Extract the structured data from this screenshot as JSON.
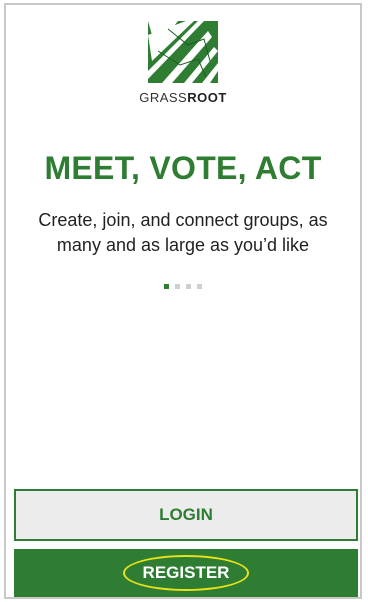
{
  "brand": {
    "name_light": "GRASS",
    "name_bold": "ROOT",
    "logo_icon": "grass-blades-logo-icon",
    "accent_color": "#2e7d32"
  },
  "onboarding": {
    "headline": "MEET, VOTE, ACT",
    "subtitle": "Create, join, and connect groups, as many and as large as you’d like",
    "page_indicator": {
      "current": 1,
      "total": 4
    }
  },
  "actions": {
    "login_label": "LOGIN",
    "register_label": "REGISTER",
    "highlight_color": "#e8e21a"
  }
}
